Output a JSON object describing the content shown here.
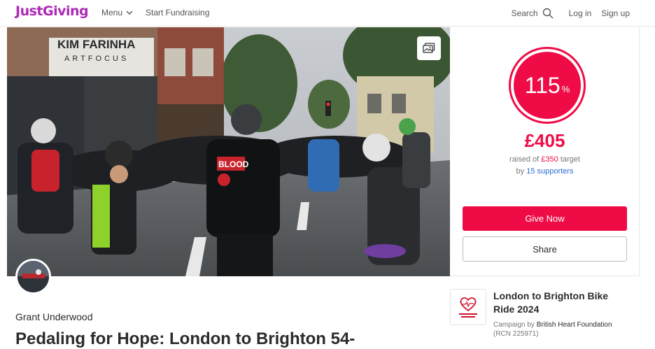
{
  "header": {
    "logo": "JustGiving",
    "menu_label": "Menu",
    "start_label": "Start Fundraising",
    "search_label": "Search",
    "login_label": "Log in",
    "signup_label": "Sign up"
  },
  "hero": {
    "shop_sign": "KIM FARINHA",
    "shop_sub": "ARTFOCUS",
    "jersey_text": "BLOOD"
  },
  "progress": {
    "percent": "115",
    "percent_sign": "%",
    "raised": "£405",
    "raised_of_prefix": "raised of ",
    "target": "£350",
    "target_suffix": " target",
    "by_prefix": "by ",
    "supporters": "15 supporters",
    "give_label": "Give Now",
    "share_label": "Share"
  },
  "fundraiser": {
    "owner_name": "Grant Underwood",
    "title": "Pedaling for Hope: London to Brighton 54-"
  },
  "campaign": {
    "title": "London to Brighton Bike Ride 2024",
    "by_prefix": "Campaign by ",
    "charity": "British Heart Foundation",
    "rcn": "(RCN 225971)"
  },
  "colors": {
    "brand": "#ad29b6",
    "accent": "#ef0c46",
    "link": "#2d6cd3"
  }
}
